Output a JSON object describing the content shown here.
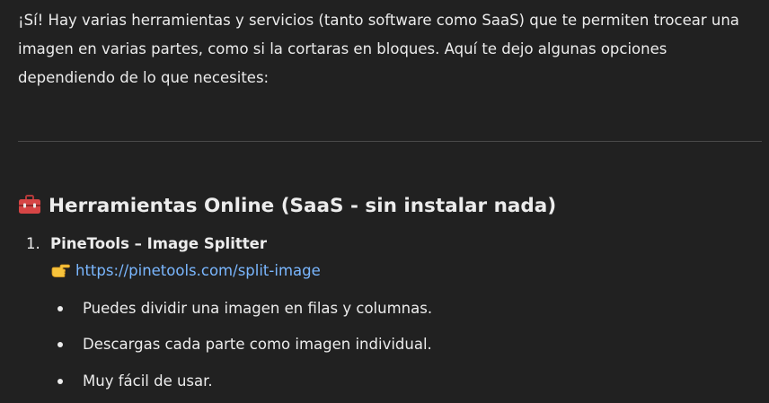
{
  "intro": "¡Sí! Hay varias herramientas y servicios (tanto software como SaaS) que te permiten trocear una imagen en varias partes, como si la cortaras en bloques. Aquí te dejo algunas opciones dependiendo de lo que necesites:",
  "section": {
    "icon": "toolbox-icon",
    "title": "Herramientas Online (SaaS - sin instalar nada)"
  },
  "items": [
    {
      "number": "1.",
      "title": "PineTools – Image Splitter",
      "link_icon": "pointing-hand-icon",
      "link": "https://pinetools.com/split-image",
      "bullets": [
        "Puedes dividir una imagen en filas y columnas.",
        "Descargas cada parte como imagen individual.",
        "Muy fácil de usar."
      ]
    }
  ],
  "colors": {
    "background": "#212121",
    "text": "#ececec",
    "link": "#7ab7ff",
    "divider": "#4a4a4a"
  }
}
